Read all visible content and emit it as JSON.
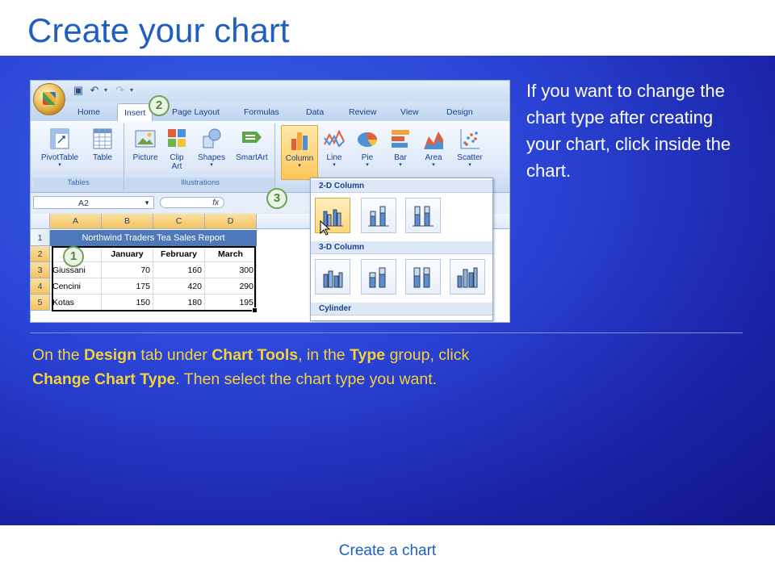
{
  "slide": {
    "title": "Create your chart",
    "side_text": "If you want to change the chart type after creating your chart, click inside the chart.",
    "bottom": {
      "p1": "On the ",
      "b1": "Design",
      "p2": " tab under ",
      "b2": "Chart Tools",
      "p3": ", in the ",
      "b3": "Type",
      "p4": " group, click ",
      "b4": "Change Chart Type",
      "p5": ". Then select the chart type you want."
    },
    "footer": "Create a chart"
  },
  "excel": {
    "tabs": [
      "Home",
      "Insert",
      "Page Layout",
      "Formulas",
      "Data",
      "Review",
      "View",
      "Design"
    ],
    "active_tab": "Insert",
    "groups": {
      "tables": {
        "label": "Tables",
        "buttons": [
          "PivotTable",
          "Table"
        ]
      },
      "illustrations": {
        "label": "Illustrations",
        "buttons": [
          "Picture",
          "Clip Art",
          "Shapes",
          "SmartArt"
        ]
      },
      "charts": {
        "buttons": [
          "Column",
          "Line",
          "Pie",
          "Bar",
          "Area",
          "Scatter"
        ]
      }
    },
    "name_box": "A2",
    "fx_label": "fx",
    "columns": [
      "A",
      "B",
      "C",
      "D"
    ],
    "rows": [
      "1",
      "2",
      "3",
      "4",
      "5"
    ],
    "banner": "Northwind Traders Tea Sales Report",
    "header_row": [
      "",
      "January",
      "February",
      "March"
    ],
    "data_rows": [
      [
        "Giussani",
        "70",
        "160",
        "300"
      ],
      [
        "Cencini",
        "175",
        "420",
        "290"
      ],
      [
        "Kotas",
        "150",
        "180",
        "195"
      ]
    ],
    "gallery": {
      "section1": "2-D Column",
      "section2": "3-D Column",
      "section3": "Cylinder"
    },
    "callouts": [
      "1",
      "2",
      "3"
    ]
  },
  "colors": {
    "title": "#1f5fbf",
    "highlight_text": "#f4d23a",
    "background": "#2a44d6"
  }
}
